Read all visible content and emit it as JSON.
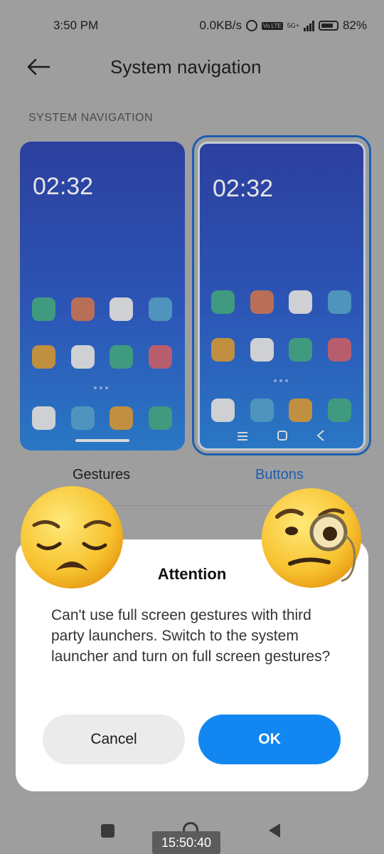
{
  "status_bar": {
    "time": "3:50 PM",
    "net_speed": "0.0KB/s",
    "volte": "Vo LTE",
    "network": "5G+",
    "battery": "82%",
    "battery_level": 0.82
  },
  "header": {
    "title": "System navigation",
    "back_icon": "arrow-left-icon"
  },
  "section": {
    "label": "SYSTEM NAVIGATION"
  },
  "options": [
    {
      "label": "Gestures",
      "clock": "02:32",
      "selected": false
    },
    {
      "label": "Buttons",
      "clock": "02:32",
      "selected": true
    }
  ],
  "colors": {
    "accent": "#1c5fb0",
    "ok_button": "#1287f2",
    "selected_label": "#1c5fb0"
  },
  "dialog": {
    "title": "Attention",
    "message": "Can't use full screen gestures with third party launchers. Switch to the system launcher and turn on full screen gestures?",
    "cancel_label": "Cancel",
    "ok_label": "OK"
  },
  "emojis": [
    "pensive-face",
    "face-with-monocle"
  ],
  "overlay": {
    "timestamp": "15:50:40"
  },
  "nav_bar": {
    "icons": [
      "square-icon",
      "circle-icon",
      "triangle-back-icon"
    ]
  }
}
